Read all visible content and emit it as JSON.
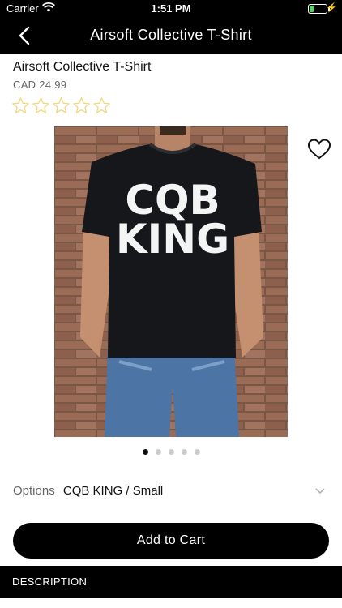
{
  "status_bar": {
    "carrier": "Carrier",
    "time": "1:51 PM",
    "battery_level": 0.25,
    "battery_color": "#4cd964"
  },
  "nav": {
    "back_icon": "chevron-left-icon",
    "title": "Airsoft Collective T-Shirt"
  },
  "product": {
    "name": "Airsoft Collective T-Shirt",
    "price": "CAD 24.99",
    "rating": 0,
    "rating_max": 5,
    "rating_color": "#f2d679",
    "image_shirt_text_line1": "CQB",
    "image_shirt_text_line2": "KING",
    "favorite_icon": "heart-outline-icon"
  },
  "carousel": {
    "count": 5,
    "active_index": 0
  },
  "options": {
    "label": "Options",
    "value": "CQB KING / Small",
    "icon": "chevron-down-icon"
  },
  "add_to_cart": {
    "label": "Add to Cart"
  },
  "description": {
    "header": "DESCRIPTION"
  }
}
